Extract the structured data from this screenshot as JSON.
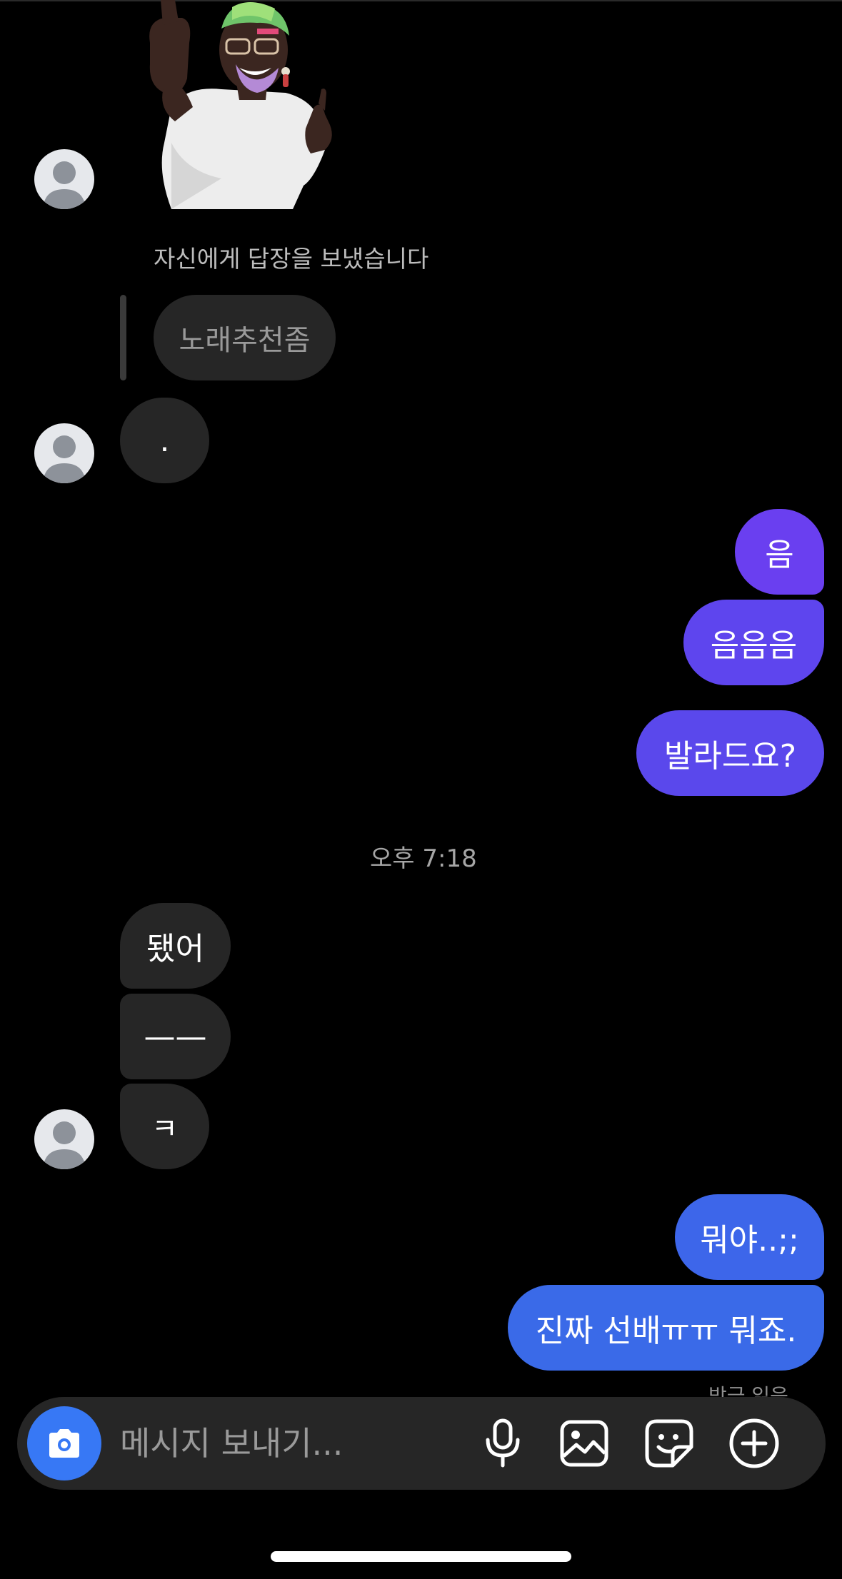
{
  "thread": {
    "reply_note": "자신에게 답장을 보냈습니다",
    "quoted_message": "노래추천좀",
    "timestamp": "오후 7:18",
    "seen_label": "방금 읽음"
  },
  "messages": {
    "m1": {
      "text": ".",
      "direction": "incoming"
    },
    "m2": {
      "text": "음",
      "direction": "outgoing"
    },
    "m3": {
      "text": "음음음",
      "direction": "outgoing"
    },
    "m4": {
      "text": "발라드요?",
      "direction": "outgoing"
    },
    "m5": {
      "text": "됐어",
      "direction": "incoming"
    },
    "m6": {
      "text": "——",
      "direction": "incoming"
    },
    "m7": {
      "text": "ㅋ",
      "direction": "incoming"
    },
    "m8": {
      "text": "뭐야..;;",
      "direction": "outgoing"
    },
    "m9": {
      "text": "진짜 선배ㅠㅠ 뭐죠.",
      "direction": "outgoing"
    }
  },
  "composer": {
    "placeholder": "메시지 보내기...",
    "icons": [
      "camera-icon",
      "microphone-icon",
      "gallery-icon",
      "sticker-icon",
      "plus-icon"
    ]
  },
  "colors": {
    "background": "#000000",
    "incoming_bubble": "#262626",
    "outgoing_purple": "#6a3ff0",
    "outgoing_blue": "#3a6ae8",
    "accent": "#3778f5"
  }
}
